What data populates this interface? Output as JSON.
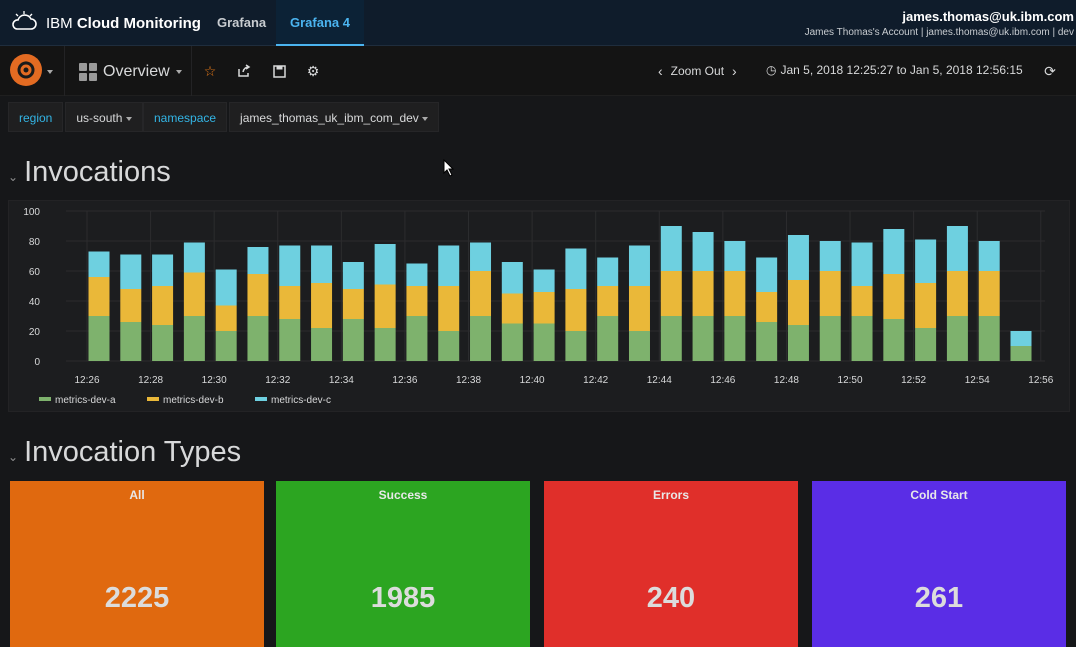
{
  "ibm": {
    "brand_regular": "IBM ",
    "brand_bold": "Cloud Monitoring",
    "nav": [
      "Grafana",
      "Grafana 4"
    ],
    "user_email": "james.thomas@uk.ibm.com",
    "user_account": "James Thomas's Account | james.thomas@uk.ibm.com | dev"
  },
  "toolbar": {
    "dashboard_title": "Overview",
    "zoom_out": "Zoom Out",
    "time_range": "Jan 5, 2018 12:25:27 to Jan 5, 2018 12:56:15"
  },
  "templating": [
    {
      "label": "region",
      "value": "us-south"
    },
    {
      "label": "namespace",
      "value": "james_thomas_uk_ibm_com_dev"
    }
  ],
  "rows": {
    "invocations": "Invocations",
    "invocation_types": "Invocation Types"
  },
  "chart_data": {
    "type": "bar",
    "stacked": true,
    "x_tick_labels": [
      "12:26",
      "12:28",
      "12:30",
      "12:32",
      "12:34",
      "12:36",
      "12:38",
      "12:40",
      "12:42",
      "12:44",
      "12:46",
      "12:48",
      "12:50",
      "12:52",
      "12:54",
      "12:56"
    ],
    "y_tick_labels": [
      "0",
      "20",
      "40",
      "60",
      "80",
      "100"
    ],
    "ylim": [
      0,
      100
    ],
    "grid": true,
    "legend_position": "bottom-left",
    "series": [
      {
        "name": "metrics-dev-a",
        "color": "#7eb26d",
        "values": [
          30,
          26,
          24,
          30,
          20,
          30,
          28,
          22,
          28,
          22,
          30,
          20,
          30,
          25,
          25,
          20,
          30,
          20,
          30,
          30,
          30,
          26,
          24,
          30,
          30,
          28,
          22,
          30,
          30,
          10
        ]
      },
      {
        "name": "metrics-dev-b",
        "color": "#eab839",
        "values": [
          26,
          22,
          26,
          29,
          17,
          28,
          22,
          30,
          20,
          29,
          20,
          30,
          30,
          20,
          21,
          28,
          20,
          30,
          30,
          30,
          30,
          20,
          30,
          30,
          20,
          30,
          30,
          30,
          30,
          0
        ]
      },
      {
        "name": "metrics-dev-c",
        "color": "#6ed0e0",
        "values": [
          17,
          23,
          21,
          20,
          24,
          18,
          27,
          25,
          18,
          27,
          15,
          27,
          19,
          21,
          15,
          27,
          19,
          27,
          30,
          26,
          20,
          23,
          30,
          20,
          29,
          30,
          29,
          30,
          20,
          10
        ]
      }
    ]
  },
  "stats": [
    {
      "title": "All",
      "value": "2225",
      "color": "#e0690f"
    },
    {
      "title": "Success",
      "value": "1985",
      "color": "#2ca521"
    },
    {
      "title": "Errors",
      "value": "240",
      "color": "#e02f2a"
    },
    {
      "title": "Cold Start",
      "value": "261",
      "color": "#5a2de6"
    }
  ]
}
